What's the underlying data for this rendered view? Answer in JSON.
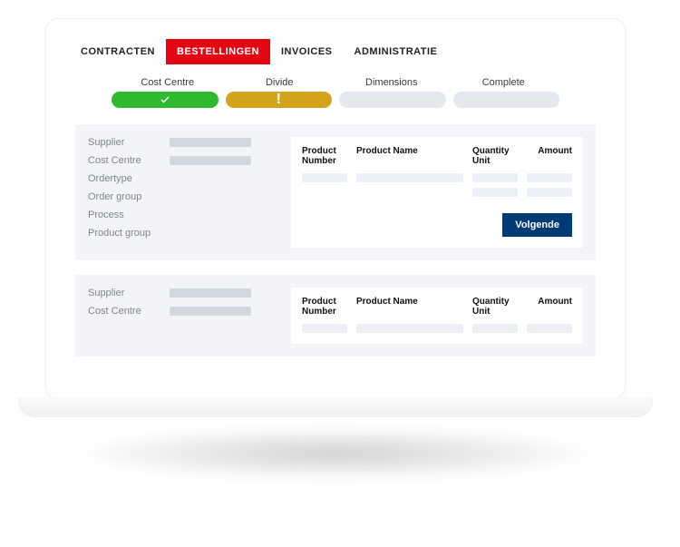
{
  "tabs": [
    {
      "label": "CONTRACTEN",
      "active": false
    },
    {
      "label": "BESTELLINGEN",
      "active": true
    },
    {
      "label": "INVOICES",
      "active": false
    },
    {
      "label": "ADMINISTRATIE",
      "active": false
    }
  ],
  "stepper": {
    "steps": [
      {
        "label": "Cost Centre",
        "state": "done"
      },
      {
        "label": "Divide",
        "state": "current"
      },
      {
        "label": "Dimensions",
        "state": "todo"
      },
      {
        "label": "Complete",
        "state": "todo"
      }
    ],
    "current_warning_glyph": "!"
  },
  "cards": [
    {
      "fields": [
        {
          "label": "Supplier",
          "has_value": true
        },
        {
          "label": "Cost Centre",
          "has_value": true
        },
        {
          "label": "Ordertype",
          "has_value": false
        },
        {
          "label": "Order group",
          "has_value": false
        },
        {
          "label": "Process",
          "has_value": false
        },
        {
          "label": "Product group",
          "has_value": false
        }
      ],
      "table": {
        "columns": [
          "Product Number",
          "Product Name",
          "Quantity Unit",
          "Amount"
        ],
        "placeholder_rows": 2
      },
      "show_next": true,
      "next_label": "Volgende"
    },
    {
      "fields": [
        {
          "label": "Supplier",
          "has_value": true
        },
        {
          "label": "Cost Centre",
          "has_value": true
        }
      ],
      "table": {
        "columns": [
          "Product Number",
          "Product Name",
          "Quantity Unit",
          "Amount"
        ],
        "placeholder_rows": 1
      },
      "show_next": false
    }
  ],
  "colors": {
    "accent": "#e30613",
    "primary_button": "#003b77",
    "step_done": "#2fb92f",
    "step_current": "#d3a31b",
    "step_todo": "#e5e8ec"
  }
}
